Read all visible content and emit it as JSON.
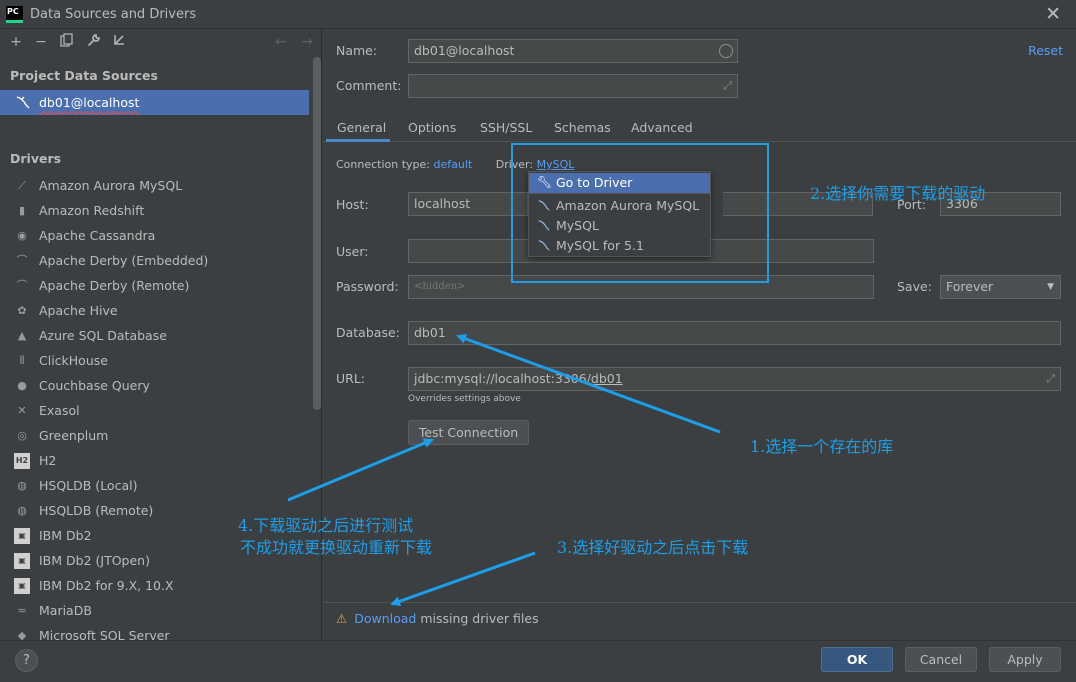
{
  "window": {
    "title": "Data Sources and Drivers",
    "app_icon_text": "PC"
  },
  "left": {
    "project_title": "Project Data Sources",
    "datasource": "db01@localhost",
    "drivers_title": "Drivers",
    "drivers": [
      {
        "label": "Amazon Aurora MySQL",
        "icon": "dolphin-icon"
      },
      {
        "label": "Amazon Redshift",
        "icon": "redshift-icon"
      },
      {
        "label": "Apache Cassandra",
        "icon": "eye-icon"
      },
      {
        "label": "Apache Derby (Embedded)",
        "icon": "derby-hat-icon"
      },
      {
        "label": "Apache Derby (Remote)",
        "icon": "derby-hat-icon"
      },
      {
        "label": "Apache Hive",
        "icon": "hive-icon"
      },
      {
        "label": "Azure SQL Database",
        "icon": "azure-icon"
      },
      {
        "label": "ClickHouse",
        "icon": "clickhouse-icon"
      },
      {
        "label": "Couchbase Query",
        "icon": "couchbase-icon"
      },
      {
        "label": "Exasol",
        "icon": "exasol-icon"
      },
      {
        "label": "Greenplum",
        "icon": "greenplum-icon"
      },
      {
        "label": "H2",
        "icon": "h2-icon"
      },
      {
        "label": "HSQLDB (Local)",
        "icon": "hsqldb-icon"
      },
      {
        "label": "HSQLDB (Remote)",
        "icon": "hsqldb-icon"
      },
      {
        "label": "IBM Db2",
        "icon": "ibm-icon"
      },
      {
        "label": "IBM Db2 (JTOpen)",
        "icon": "ibm-icon"
      },
      {
        "label": "IBM Db2 for 9.X, 10.X",
        "icon": "ibm-icon"
      },
      {
        "label": "MariaDB",
        "icon": "mariadb-icon"
      },
      {
        "label": "Microsoft SQL Server",
        "icon": "mssql-icon"
      }
    ]
  },
  "form": {
    "name_label": "Name:",
    "name_value": "db01@localhost",
    "comment_label": "Comment:",
    "reset": "Reset",
    "tabs": [
      "General",
      "Options",
      "SSH/SSL",
      "Schemas",
      "Advanced"
    ],
    "conn_type_label": "Connection type:",
    "conn_type_value": "default",
    "driver_label": "Driver:",
    "driver_value": "MySQL",
    "host_label": "Host:",
    "host_value": "localhost",
    "port_label": "Port:",
    "port_value": "3306",
    "user_label": "User:",
    "password_label": "Password:",
    "password_placeholder": "<hidden>",
    "save_label": "Save:",
    "save_value": "Forever",
    "database_label": "Database:",
    "database_value": "db01",
    "url_label": "URL:",
    "url_value_prefix": "jdbc:mysql://localhost:3306/",
    "url_value_db": "db01",
    "url_note": "Overrides settings above",
    "test_connection": "Test Connection",
    "download_link": "Download",
    "download_rest": " missing driver files"
  },
  "popup": {
    "go_to_driver": "Go to Driver",
    "items": [
      "Amazon Aurora MySQL",
      "MySQL",
      "MySQL for 5.1"
    ]
  },
  "buttons": {
    "ok": "OK",
    "cancel": "Cancel",
    "apply": "Apply",
    "help": "?"
  },
  "annotations": {
    "a1": "1.选择一个存在的库",
    "a2": "2.选择你需要下载的驱动",
    "a3": "3.选择好驱动之后点击下载",
    "a4_line1": "4.下载驱动之后进行测试",
    "a4_line2": "不成功就更换驱动重新下载"
  },
  "colors": {
    "accent": "#4b6eaf",
    "link": "#589df6",
    "annotation": "#1e9ee8",
    "warning": "#e8a33d"
  }
}
